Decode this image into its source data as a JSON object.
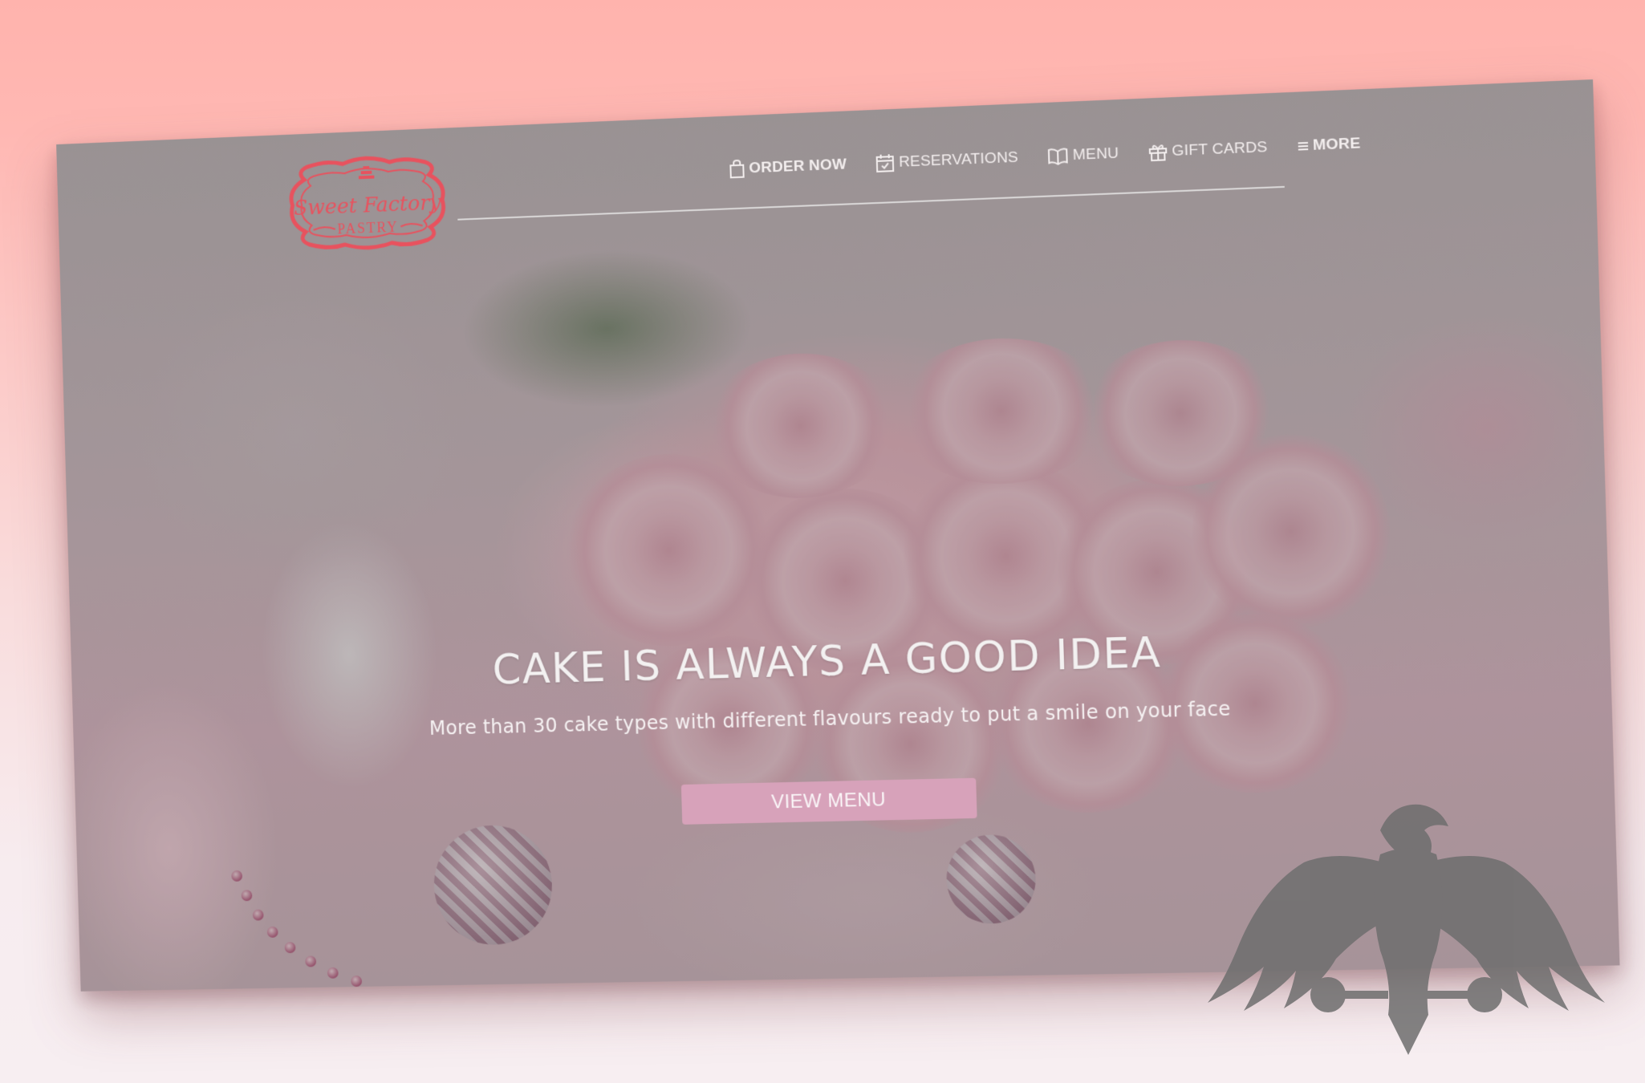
{
  "brand": {
    "name_line1": "Sweet Factory",
    "name_line2": "PASTRY",
    "color": "#e8525e"
  },
  "nav": {
    "items": [
      {
        "label": "ORDER NOW",
        "icon": "shopping-bag-icon"
      },
      {
        "label": "RESERVATIONS",
        "icon": "calendar-check-icon"
      },
      {
        "label": "MENU",
        "icon": "open-book-icon"
      },
      {
        "label": "GIFT CARDS",
        "icon": "gift-icon"
      },
      {
        "label": "MORE",
        "icon": "hamburger-menu-icon"
      }
    ]
  },
  "hero": {
    "title": "CAKE IS ALWAYS A GOOD IDEA",
    "subtitle": "More than 30 cake types with different flavours ready to put a smile on your face",
    "button_label": "VIEW MENU",
    "button_color": "#d7a2ba"
  },
  "colors": {
    "background_top": "#ffb3ad",
    "background_bottom": "#f7eef1",
    "watermark": "#6e6e6e"
  },
  "watermark": {
    "icon": "eagle-silhouette-icon"
  }
}
